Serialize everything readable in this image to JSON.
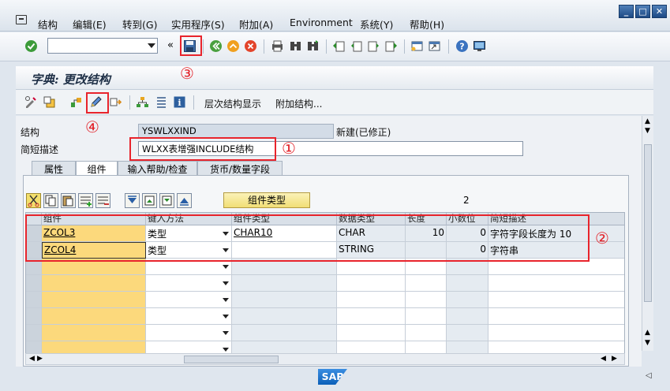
{
  "menu": {
    "items": [
      "结构",
      "编辑(E)",
      "转到(G)",
      "实用程序(S)",
      "附加(A)",
      "Environment",
      "系统(Y)",
      "帮助(H)"
    ]
  },
  "toolbar": {
    "command_field_value": "",
    "icons": [
      "check-icon",
      "save-icon",
      "back-icon",
      "exit-icon",
      "cancel-icon",
      "print-icon",
      "find-icon",
      "find-next-icon",
      "first-page-icon",
      "prev-page-icon",
      "next-page-icon",
      "last-page-icon",
      "new-session-icon",
      "shortcut-icon",
      "help-icon",
      "layout-icon"
    ],
    "separator_glyph": "«"
  },
  "title": "字典: 更改结构",
  "app_toolbar": {
    "hierarchy_label": "层次结构显示",
    "append_label": "附加结构..."
  },
  "header": {
    "structure_label": "结构",
    "structure_value": "YSWLXXIND",
    "status_text": "新建(已修正)",
    "short_desc_label": "简短描述",
    "short_desc_value": "WLXX表增强INCLUDE结构"
  },
  "tabs": [
    {
      "label": "属性",
      "active": false
    },
    {
      "label": "组件",
      "active": true
    },
    {
      "label": "输入帮助/检查",
      "active": false
    },
    {
      "label": "货币/数量字段",
      "active": false
    }
  ],
  "grid": {
    "component_type_button": "组件类型",
    "counter": "2",
    "columns": [
      "组件",
      "键入方法",
      "组件类型",
      "数据类型",
      "长度",
      "小数位",
      "简短描述"
    ],
    "rows": [
      {
        "component": "ZCOL3",
        "typing": "类型",
        "comp_type": "CHAR10",
        "data_type": "CHAR",
        "length": "10",
        "decimals": "0",
        "desc": "字符字段长度为 10"
      },
      {
        "component": "ZCOL4",
        "typing": "类型",
        "comp_type": "",
        "data_type": "STRING",
        "length": "",
        "decimals": "0",
        "desc": "字符串"
      }
    ]
  },
  "annotations": [
    "①",
    "②",
    "③",
    "④"
  ],
  "colors": {
    "annotation_red": "#e8242c",
    "key_column": "#fcd97c",
    "sap_blue": "#0b5fb8"
  },
  "footer": {
    "logo_text": "SAP"
  }
}
